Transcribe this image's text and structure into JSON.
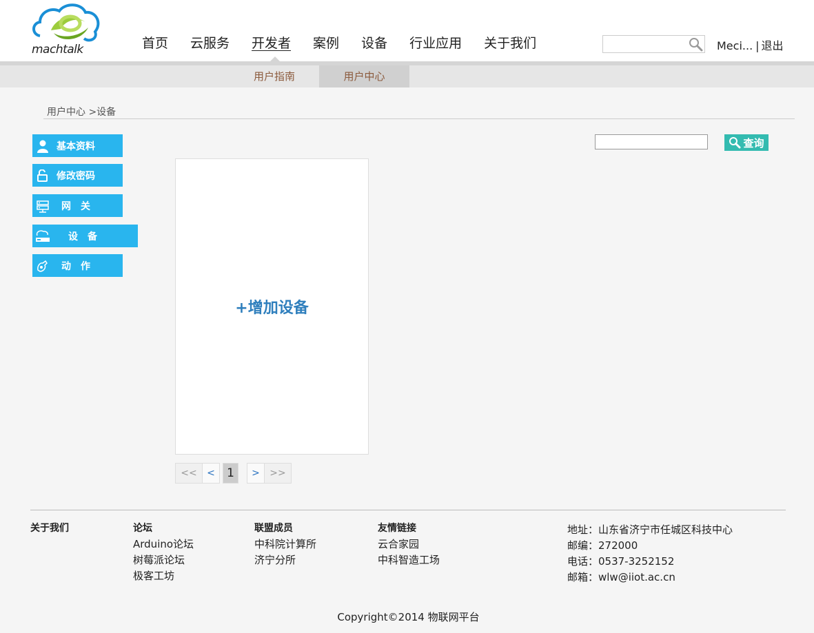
{
  "header": {
    "logo_text": "machtalk",
    "nav": [
      "首页",
      "云服务",
      "开发者",
      "案例",
      "设备",
      "行业应用",
      "关于我们"
    ],
    "nav_active_index": 2,
    "search_placeholder": "",
    "user_name": "Meci...",
    "separator": "|",
    "logout": "退出"
  },
  "subnav": {
    "guide": "用户指南",
    "center": "用户中心"
  },
  "breadcrumb": "用户中心 >设备",
  "sidebar": {
    "items": [
      {
        "label": "基本资料",
        "icon": "user-icon"
      },
      {
        "label": "修改密码",
        "icon": "lock-icon"
      },
      {
        "label": "网　关",
        "icon": "gateway-icon"
      },
      {
        "label": "设　备",
        "icon": "device-icon"
      },
      {
        "label": "动　作",
        "icon": "action-icon"
      }
    ]
  },
  "content": {
    "search_value": "",
    "query_label": "查询",
    "add_device_label": "+增加设备"
  },
  "pager": {
    "first": "<<",
    "prev": "<",
    "current": "1",
    "next": ">",
    "last": ">>"
  },
  "footer": {
    "about": "关于我们",
    "forum": {
      "title": "论坛",
      "links": [
        "Arduino论坛",
        "树莓派论坛",
        "极客工坊"
      ]
    },
    "members": {
      "title": "联盟成员",
      "links": [
        "中科院计算所",
        "济宁分所"
      ]
    },
    "friends": {
      "title": "友情链接",
      "links": [
        "云合家园",
        "中科智造工场"
      ]
    },
    "contact": [
      "地址：山东省济宁市任城区科技中心",
      "邮编：272000",
      "电话：0537-3252152",
      "邮箱：wlw@iiot.ac.cn"
    ],
    "copyright": "Copyright©2014 物联网平台"
  },
  "colors": {
    "sidebar_bg": "#29b5ee",
    "query_btn_bg": "#33bbb0",
    "add_device_text": "#2f7fbd",
    "subnav_text": "#8b5a3c"
  }
}
